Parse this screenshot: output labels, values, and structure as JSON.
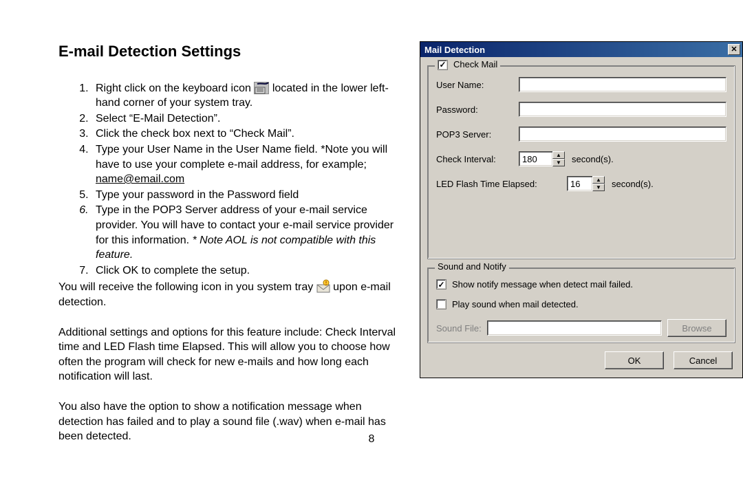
{
  "title": "E-mail Detection Settings",
  "steps": {
    "s1a": "Right click on the keyboard icon",
    "s1b": "located in the lower left-hand corner of your system tray.",
    "s2": "Select “E-Mail Detection”.",
    "s3": "Click the check box next to “Check Mail”.",
    "s4a": "Type your User Name in the User Name field. *Note you will have to use your complete e-mail address, for example; ",
    "s4b": "name@email.com",
    "s5": "Type your password in the Password field",
    "s6a": "Type in the POP3 Server address of your e-mail service provider. You will have to contact your e-mail service provider for this information.",
    "s6b": " * Note AOL is not compatible with this feature.",
    "s7": "Click OK to complete the setup."
  },
  "after_list_a": "You will receive the following icon in you system tray",
  "after_list_b": "upon e-mail detection.",
  "para1": "Additional settings and options for this feature include: Check Interval time and LED Flash time Elapsed. This will allow you to choose how often the program will check for new e-mails and how long each notification will last.",
  "para2": "You also have the option to show a notification message when detection has failed and to play a sound file (.wav) when e-mail has been detected.",
  "page_number": "8",
  "dialog": {
    "title": "Mail Detection",
    "group_checkmail": "Check Mail",
    "username_label": "User Name:",
    "password_label": "Password:",
    "pop3_label": "POP3 Server:",
    "interval_label": "Check Interval:",
    "interval_value": "180",
    "interval_unit": "second(s).",
    "led_label": "LED Flash Time Elapsed:",
    "led_value": "16",
    "led_unit": "second(s).",
    "group_sound": "Sound and Notify",
    "notify_label": "Show notify message when detect mail failed.",
    "play_label": "Play sound when mail detected.",
    "soundfile_label": "Sound File:",
    "browse": "Browse",
    "ok": "OK",
    "cancel": "Cancel"
  }
}
